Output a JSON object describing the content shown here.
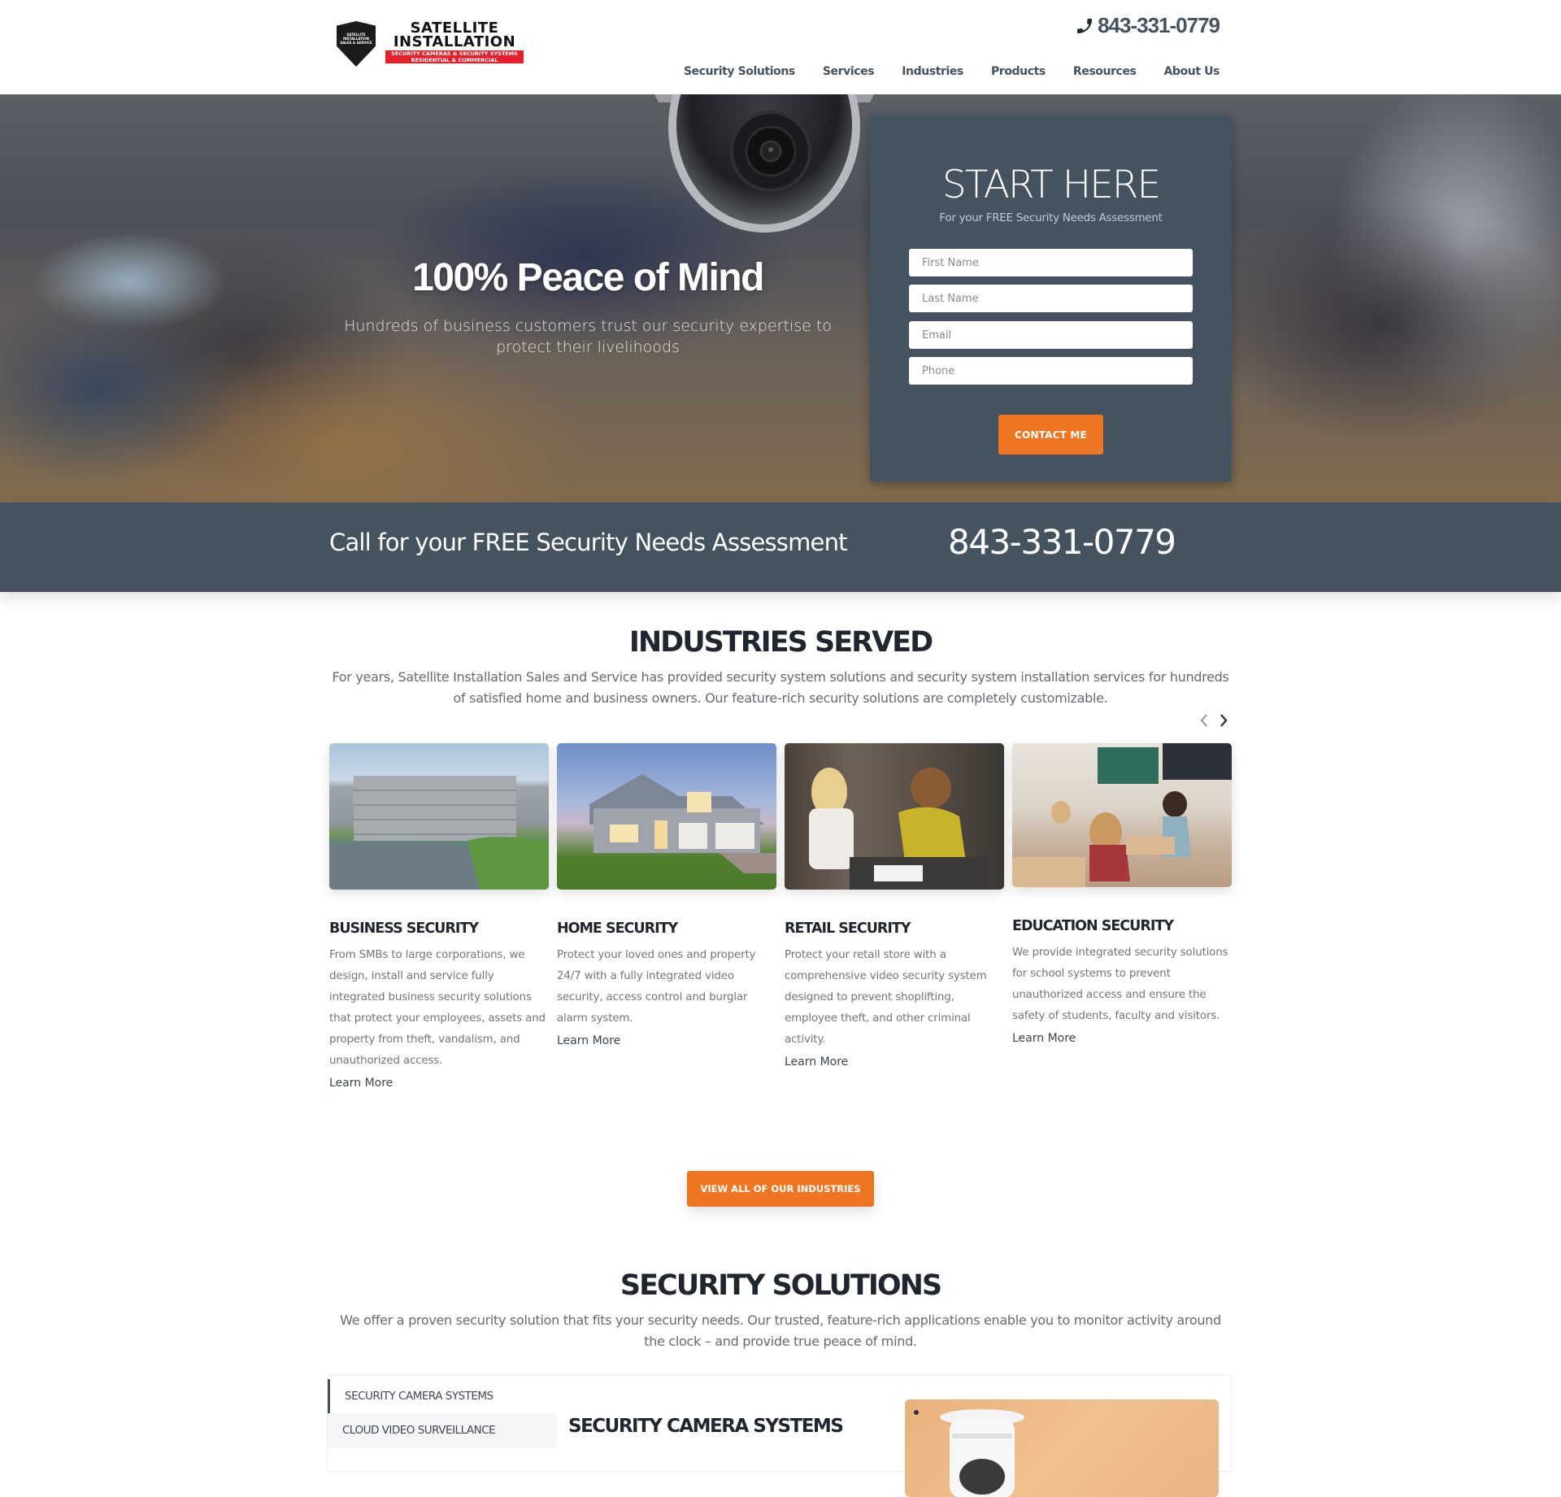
{
  "header": {
    "logo": {
      "shield_text": "SATELLITE INSTALLATION SALES & SERVICE",
      "title_line1": "SATELLITE",
      "title_line2": "INSTALLATION",
      "ribbon_line1": "SECURITY CAMERAS & SECURITY SYSTEMS",
      "ribbon_line2": "RESIDENTIAL & COMMERCIAL"
    },
    "phone": "843-331-0779",
    "phone_icon": "phone-icon",
    "nav": [
      {
        "label": "Security Solutions"
      },
      {
        "label": "Services"
      },
      {
        "label": "Industries"
      },
      {
        "label": "Products"
      },
      {
        "label": "Resources"
      },
      {
        "label": "About Us"
      }
    ]
  },
  "hero": {
    "headline": "100% Peace of Mind",
    "subtext": "Hundreds of business customers trust our security expertise to protect their livelihoods",
    "form": {
      "title": "START HERE",
      "subtitle": "For your FREE Security Needs Assessment",
      "fields": [
        {
          "placeholder": "First Name",
          "value": ""
        },
        {
          "placeholder": "Last Name",
          "value": ""
        },
        {
          "placeholder": "Email",
          "value": ""
        },
        {
          "placeholder": "Phone",
          "value": ""
        }
      ],
      "submit_label": "CONTACT ME"
    }
  },
  "call_bar": {
    "text": "Call for your FREE Security Needs Assessment",
    "phone": "843-331-0779"
  },
  "industries": {
    "title": "INDUSTRIES SERVED",
    "description": "For years, Satellite Installation Sales and Service has provided security system solutions and security system installation services for hundreds of satisfied home and business owners. Our feature-rich security solutions are completely customizable.",
    "prev_icon": "chevron-left-icon",
    "next_icon": "chevron-right-icon",
    "cards": [
      {
        "title": "BUSINESS SECURITY",
        "text": "From SMBs to large corporations, we design, install and service fully integrated business security solutions that protect your employees, assets and property from theft, vandalism, and unauthorized access.",
        "link": "Learn More",
        "image": "office-building-photo"
      },
      {
        "title": "HOME SECURITY",
        "text": "Protect your loved ones and property 24/7 with a fully integrated video security, access control and burglar alarm system.",
        "link": "Learn More",
        "image": "house-photo"
      },
      {
        "title": "RETAIL SECURITY",
        "text": "Protect your retail store with a comprehensive video security system designed to prevent shoplifting, employee theft, and other criminal activity.",
        "link": "Learn More",
        "image": "retail-store-photo"
      },
      {
        "title": "EDUCATION SECURITY",
        "text": "We provide integrated security solutions for school systems to prevent unauthorized access and ensure the safety of students, faculty and visitors.",
        "link": "Learn More",
        "image": "classroom-photo"
      }
    ],
    "view_all_label": "VIEW ALL OF OUR INDUSTRIES"
  },
  "solutions": {
    "title": "SECURITY SOLUTIONS",
    "description": "We offer a proven security solution that fits your security needs. Our trusted, feature-rich applications enable you to monitor activity around the clock – and provide true peace of mind.",
    "tabs": [
      {
        "label": "SECURITY CAMERA SYSTEMS",
        "active": true
      },
      {
        "label": "CLOUD VIDEO SURVEILLANCE",
        "active": false
      }
    ],
    "panel_title": "SECURITY CAMERA SYSTEMS"
  },
  "colors": {
    "accent_orange": "#ee7623",
    "slate": "#45525f",
    "heading": "#1f2630",
    "body_text": "#727579"
  }
}
